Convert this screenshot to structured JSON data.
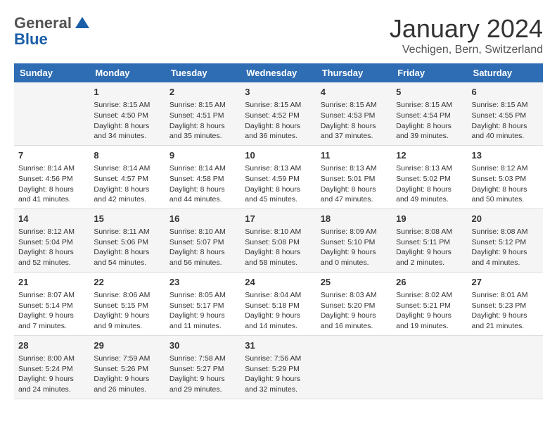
{
  "header": {
    "logo_general": "General",
    "logo_blue": "Blue",
    "month_year": "January 2024",
    "location": "Vechigen, Bern, Switzerland"
  },
  "days_of_week": [
    "Sunday",
    "Monday",
    "Tuesday",
    "Wednesday",
    "Thursday",
    "Friday",
    "Saturday"
  ],
  "weeks": [
    [
      {
        "day": "",
        "sunrise": "",
        "sunset": "",
        "daylight": ""
      },
      {
        "day": "1",
        "sunrise": "Sunrise: 8:15 AM",
        "sunset": "Sunset: 4:50 PM",
        "daylight": "Daylight: 8 hours and 34 minutes."
      },
      {
        "day": "2",
        "sunrise": "Sunrise: 8:15 AM",
        "sunset": "Sunset: 4:51 PM",
        "daylight": "Daylight: 8 hours and 35 minutes."
      },
      {
        "day": "3",
        "sunrise": "Sunrise: 8:15 AM",
        "sunset": "Sunset: 4:52 PM",
        "daylight": "Daylight: 8 hours and 36 minutes."
      },
      {
        "day": "4",
        "sunrise": "Sunrise: 8:15 AM",
        "sunset": "Sunset: 4:53 PM",
        "daylight": "Daylight: 8 hours and 37 minutes."
      },
      {
        "day": "5",
        "sunrise": "Sunrise: 8:15 AM",
        "sunset": "Sunset: 4:54 PM",
        "daylight": "Daylight: 8 hours and 39 minutes."
      },
      {
        "day": "6",
        "sunrise": "Sunrise: 8:15 AM",
        "sunset": "Sunset: 4:55 PM",
        "daylight": "Daylight: 8 hours and 40 minutes."
      }
    ],
    [
      {
        "day": "7",
        "sunrise": "Sunrise: 8:14 AM",
        "sunset": "Sunset: 4:56 PM",
        "daylight": "Daylight: 8 hours and 41 minutes."
      },
      {
        "day": "8",
        "sunrise": "Sunrise: 8:14 AM",
        "sunset": "Sunset: 4:57 PM",
        "daylight": "Daylight: 8 hours and 42 minutes."
      },
      {
        "day": "9",
        "sunrise": "Sunrise: 8:14 AM",
        "sunset": "Sunset: 4:58 PM",
        "daylight": "Daylight: 8 hours and 44 minutes."
      },
      {
        "day": "10",
        "sunrise": "Sunrise: 8:13 AM",
        "sunset": "Sunset: 4:59 PM",
        "daylight": "Daylight: 8 hours and 45 minutes."
      },
      {
        "day": "11",
        "sunrise": "Sunrise: 8:13 AM",
        "sunset": "Sunset: 5:01 PM",
        "daylight": "Daylight: 8 hours and 47 minutes."
      },
      {
        "day": "12",
        "sunrise": "Sunrise: 8:13 AM",
        "sunset": "Sunset: 5:02 PM",
        "daylight": "Daylight: 8 hours and 49 minutes."
      },
      {
        "day": "13",
        "sunrise": "Sunrise: 8:12 AM",
        "sunset": "Sunset: 5:03 PM",
        "daylight": "Daylight: 8 hours and 50 minutes."
      }
    ],
    [
      {
        "day": "14",
        "sunrise": "Sunrise: 8:12 AM",
        "sunset": "Sunset: 5:04 PM",
        "daylight": "Daylight: 8 hours and 52 minutes."
      },
      {
        "day": "15",
        "sunrise": "Sunrise: 8:11 AM",
        "sunset": "Sunset: 5:06 PM",
        "daylight": "Daylight: 8 hours and 54 minutes."
      },
      {
        "day": "16",
        "sunrise": "Sunrise: 8:10 AM",
        "sunset": "Sunset: 5:07 PM",
        "daylight": "Daylight: 8 hours and 56 minutes."
      },
      {
        "day": "17",
        "sunrise": "Sunrise: 8:10 AM",
        "sunset": "Sunset: 5:08 PM",
        "daylight": "Daylight: 8 hours and 58 minutes."
      },
      {
        "day": "18",
        "sunrise": "Sunrise: 8:09 AM",
        "sunset": "Sunset: 5:10 PM",
        "daylight": "Daylight: 9 hours and 0 minutes."
      },
      {
        "day": "19",
        "sunrise": "Sunrise: 8:08 AM",
        "sunset": "Sunset: 5:11 PM",
        "daylight": "Daylight: 9 hours and 2 minutes."
      },
      {
        "day": "20",
        "sunrise": "Sunrise: 8:08 AM",
        "sunset": "Sunset: 5:12 PM",
        "daylight": "Daylight: 9 hours and 4 minutes."
      }
    ],
    [
      {
        "day": "21",
        "sunrise": "Sunrise: 8:07 AM",
        "sunset": "Sunset: 5:14 PM",
        "daylight": "Daylight: 9 hours and 7 minutes."
      },
      {
        "day": "22",
        "sunrise": "Sunrise: 8:06 AM",
        "sunset": "Sunset: 5:15 PM",
        "daylight": "Daylight: 9 hours and 9 minutes."
      },
      {
        "day": "23",
        "sunrise": "Sunrise: 8:05 AM",
        "sunset": "Sunset: 5:17 PM",
        "daylight": "Daylight: 9 hours and 11 minutes."
      },
      {
        "day": "24",
        "sunrise": "Sunrise: 8:04 AM",
        "sunset": "Sunset: 5:18 PM",
        "daylight": "Daylight: 9 hours and 14 minutes."
      },
      {
        "day": "25",
        "sunrise": "Sunrise: 8:03 AM",
        "sunset": "Sunset: 5:20 PM",
        "daylight": "Daylight: 9 hours and 16 minutes."
      },
      {
        "day": "26",
        "sunrise": "Sunrise: 8:02 AM",
        "sunset": "Sunset: 5:21 PM",
        "daylight": "Daylight: 9 hours and 19 minutes."
      },
      {
        "day": "27",
        "sunrise": "Sunrise: 8:01 AM",
        "sunset": "Sunset: 5:23 PM",
        "daylight": "Daylight: 9 hours and 21 minutes."
      }
    ],
    [
      {
        "day": "28",
        "sunrise": "Sunrise: 8:00 AM",
        "sunset": "Sunset: 5:24 PM",
        "daylight": "Daylight: 9 hours and 24 minutes."
      },
      {
        "day": "29",
        "sunrise": "Sunrise: 7:59 AM",
        "sunset": "Sunset: 5:26 PM",
        "daylight": "Daylight: 9 hours and 26 minutes."
      },
      {
        "day": "30",
        "sunrise": "Sunrise: 7:58 AM",
        "sunset": "Sunset: 5:27 PM",
        "daylight": "Daylight: 9 hours and 29 minutes."
      },
      {
        "day": "31",
        "sunrise": "Sunrise: 7:56 AM",
        "sunset": "Sunset: 5:29 PM",
        "daylight": "Daylight: 9 hours and 32 minutes."
      },
      {
        "day": "",
        "sunrise": "",
        "sunset": "",
        "daylight": ""
      },
      {
        "day": "",
        "sunrise": "",
        "sunset": "",
        "daylight": ""
      },
      {
        "day": "",
        "sunrise": "",
        "sunset": "",
        "daylight": ""
      }
    ]
  ]
}
